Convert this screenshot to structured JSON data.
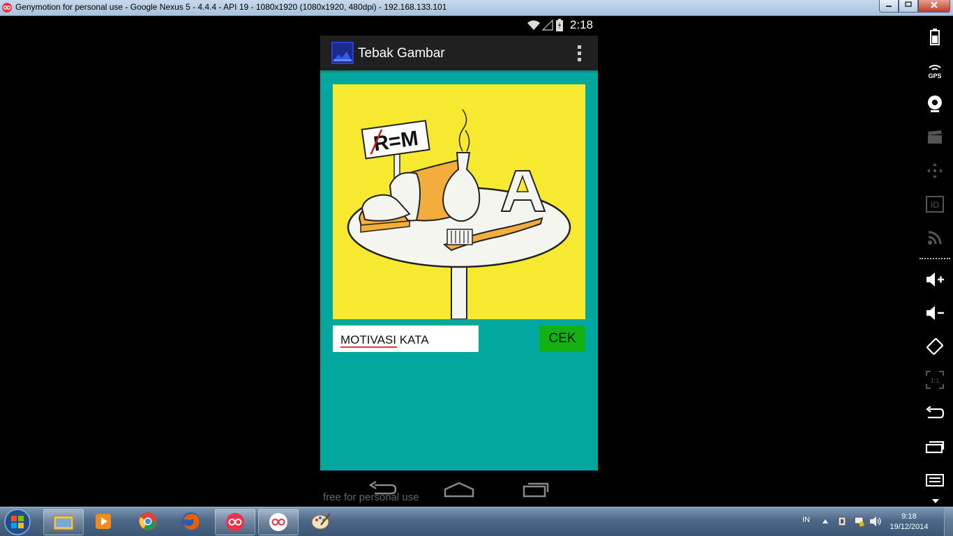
{
  "window": {
    "title": "Genymotion for personal use - Google Nexus 5 - 4.4.4 - API 19 - 1080x1920 (1080x1920, 480dpi) - 192.168.133.101",
    "buttons": [
      "minimize-icon",
      "maximize-icon",
      "close-icon"
    ]
  },
  "statusbar": {
    "time": "2:18",
    "icons": [
      "wifi-icon",
      "signal-icon",
      "battery-icon"
    ]
  },
  "app": {
    "title": "Tebak Gambar",
    "puzzle": {
      "sign_text": "R=M",
      "letter": "A",
      "colors": {
        "background": "#f6e92f",
        "bread": "#f3ad3c",
        "table": "#f5f5f0"
      }
    },
    "answer_value": "MOTIVASI KATA",
    "check_button": "CEK",
    "colors": {
      "content_bg": "#02a89e",
      "actionbar_bg": "#202020",
      "button_bg": "#14b014"
    }
  },
  "navbar": {
    "buttons": [
      "back-icon",
      "home-icon",
      "recents-icon"
    ]
  },
  "watermark": "free for personal use",
  "genymotion_toolbar": {
    "items": [
      {
        "name": "battery-widget",
        "label": ""
      },
      {
        "name": "gps-widget",
        "label": "GPS"
      },
      {
        "name": "webcam-widget",
        "label": ""
      },
      {
        "name": "screencast-widget",
        "label": ""
      },
      {
        "name": "remote-control-widget",
        "label": ""
      },
      {
        "name": "device-id-widget",
        "label": "ID"
      },
      {
        "name": "rss-widget",
        "label": ""
      },
      {
        "name": "volume-up-button",
        "label": ""
      },
      {
        "name": "volume-down-button",
        "label": ""
      },
      {
        "name": "rotate-button",
        "label": ""
      },
      {
        "name": "pixel-perfect-button",
        "label": "1:1"
      },
      {
        "name": "back-button",
        "label": ""
      },
      {
        "name": "recents-button",
        "label": ""
      },
      {
        "name": "menu-button",
        "label": ""
      }
    ]
  },
  "taskbar": {
    "apps": [
      "windows-explorer",
      "media-player",
      "chrome",
      "firefox",
      "genymotion",
      "genymotion-device",
      "paint"
    ],
    "language": "IN",
    "time": "9:18",
    "date": "19/12/2014"
  }
}
